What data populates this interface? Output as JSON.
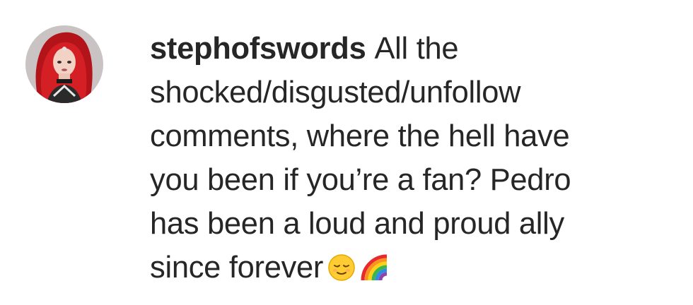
{
  "comment": {
    "username": "stephofswords",
    "lines": [
      "All the",
      "shocked/disgusted/unfollow",
      "comments, where the hell have",
      "you been if you’re a fan? Pedro",
      "has been a loud and proud ally",
      "since forever"
    ],
    "emojis": [
      "relieved-face-emoji",
      "rainbow-emoji"
    ]
  }
}
